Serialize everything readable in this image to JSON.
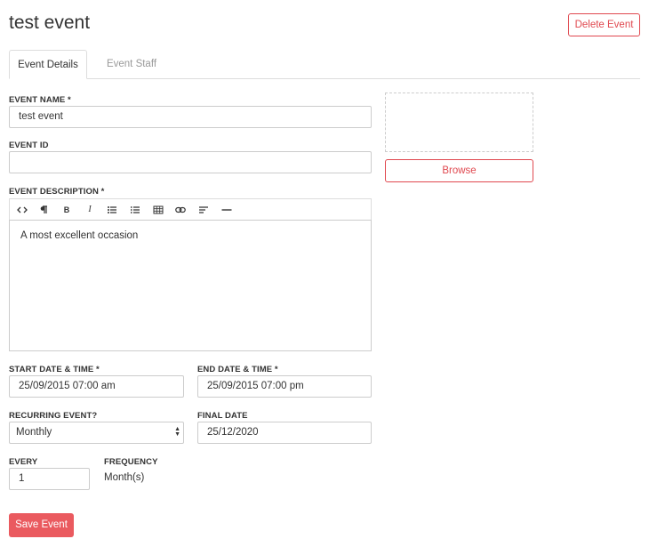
{
  "header": {
    "title": "test event",
    "delete_label": "Delete Event"
  },
  "tabs": [
    {
      "label": "Event Details",
      "active": true
    },
    {
      "label": "Event Staff",
      "active": false
    }
  ],
  "form": {
    "event_name": {
      "label": "EVENT NAME *",
      "value": "test event"
    },
    "event_id": {
      "label": "EVENT ID",
      "value": ""
    },
    "event_description": {
      "label": "EVENT DESCRIPTION *",
      "value": "A most excellent occasion",
      "toolbar": [
        "code-view-icon",
        "paragraph-icon",
        "bold-icon",
        "italic-icon",
        "bullet-list-icon",
        "numbered-list-icon",
        "table-icon",
        "link-icon",
        "align-icon",
        "horizontal-rule-icon"
      ]
    },
    "start_datetime": {
      "label": "START DATE & TIME *",
      "value": "25/09/2015 07:00 am"
    },
    "end_datetime": {
      "label": "END DATE & TIME *",
      "value": "25/09/2015 07:00 pm"
    },
    "recurring": {
      "label": "RECURRING EVENT?",
      "value": "Monthly"
    },
    "final_date": {
      "label": "FINAL DATE",
      "value": "25/12/2020"
    },
    "every": {
      "label": "EVERY",
      "value": "1"
    },
    "frequency": {
      "label": "FREQUENCY",
      "value": "Month(s)"
    }
  },
  "image": {
    "browse_label": "Browse"
  },
  "footer": {
    "save_label": "Save Event"
  },
  "colors": {
    "accent": "#e0484f",
    "save_bg": "#ea5a5f"
  }
}
